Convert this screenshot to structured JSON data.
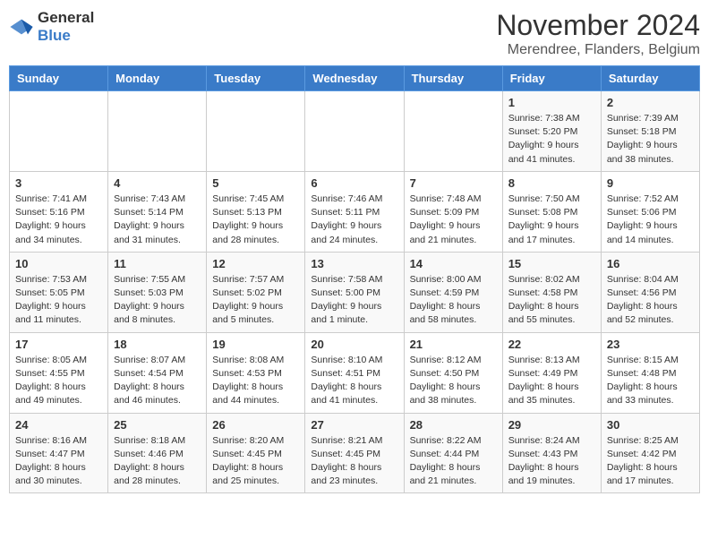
{
  "logo": {
    "text_general": "General",
    "text_blue": "Blue"
  },
  "title": {
    "month": "November 2024",
    "location": "Merendree, Flanders, Belgium"
  },
  "weekdays": [
    "Sunday",
    "Monday",
    "Tuesday",
    "Wednesday",
    "Thursday",
    "Friday",
    "Saturday"
  ],
  "weeks": [
    [
      null,
      null,
      null,
      null,
      null,
      {
        "day": "1",
        "sunrise": "Sunrise: 7:38 AM",
        "sunset": "Sunset: 5:20 PM",
        "daylight": "Daylight: 9 hours and 41 minutes."
      },
      {
        "day": "2",
        "sunrise": "Sunrise: 7:39 AM",
        "sunset": "Sunset: 5:18 PM",
        "daylight": "Daylight: 9 hours and 38 minutes."
      }
    ],
    [
      {
        "day": "3",
        "sunrise": "Sunrise: 7:41 AM",
        "sunset": "Sunset: 5:16 PM",
        "daylight": "Daylight: 9 hours and 34 minutes."
      },
      {
        "day": "4",
        "sunrise": "Sunrise: 7:43 AM",
        "sunset": "Sunset: 5:14 PM",
        "daylight": "Daylight: 9 hours and 31 minutes."
      },
      {
        "day": "5",
        "sunrise": "Sunrise: 7:45 AM",
        "sunset": "Sunset: 5:13 PM",
        "daylight": "Daylight: 9 hours and 28 minutes."
      },
      {
        "day": "6",
        "sunrise": "Sunrise: 7:46 AM",
        "sunset": "Sunset: 5:11 PM",
        "daylight": "Daylight: 9 hours and 24 minutes."
      },
      {
        "day": "7",
        "sunrise": "Sunrise: 7:48 AM",
        "sunset": "Sunset: 5:09 PM",
        "daylight": "Daylight: 9 hours and 21 minutes."
      },
      {
        "day": "8",
        "sunrise": "Sunrise: 7:50 AM",
        "sunset": "Sunset: 5:08 PM",
        "daylight": "Daylight: 9 hours and 17 minutes."
      },
      {
        "day": "9",
        "sunrise": "Sunrise: 7:52 AM",
        "sunset": "Sunset: 5:06 PM",
        "daylight": "Daylight: 9 hours and 14 minutes."
      }
    ],
    [
      {
        "day": "10",
        "sunrise": "Sunrise: 7:53 AM",
        "sunset": "Sunset: 5:05 PM",
        "daylight": "Daylight: 9 hours and 11 minutes."
      },
      {
        "day": "11",
        "sunrise": "Sunrise: 7:55 AM",
        "sunset": "Sunset: 5:03 PM",
        "daylight": "Daylight: 9 hours and 8 minutes."
      },
      {
        "day": "12",
        "sunrise": "Sunrise: 7:57 AM",
        "sunset": "Sunset: 5:02 PM",
        "daylight": "Daylight: 9 hours and 5 minutes."
      },
      {
        "day": "13",
        "sunrise": "Sunrise: 7:58 AM",
        "sunset": "Sunset: 5:00 PM",
        "daylight": "Daylight: 9 hours and 1 minute."
      },
      {
        "day": "14",
        "sunrise": "Sunrise: 8:00 AM",
        "sunset": "Sunset: 4:59 PM",
        "daylight": "Daylight: 8 hours and 58 minutes."
      },
      {
        "day": "15",
        "sunrise": "Sunrise: 8:02 AM",
        "sunset": "Sunset: 4:58 PM",
        "daylight": "Daylight: 8 hours and 55 minutes."
      },
      {
        "day": "16",
        "sunrise": "Sunrise: 8:04 AM",
        "sunset": "Sunset: 4:56 PM",
        "daylight": "Daylight: 8 hours and 52 minutes."
      }
    ],
    [
      {
        "day": "17",
        "sunrise": "Sunrise: 8:05 AM",
        "sunset": "Sunset: 4:55 PM",
        "daylight": "Daylight: 8 hours and 49 minutes."
      },
      {
        "day": "18",
        "sunrise": "Sunrise: 8:07 AM",
        "sunset": "Sunset: 4:54 PM",
        "daylight": "Daylight: 8 hours and 46 minutes."
      },
      {
        "day": "19",
        "sunrise": "Sunrise: 8:08 AM",
        "sunset": "Sunset: 4:53 PM",
        "daylight": "Daylight: 8 hours and 44 minutes."
      },
      {
        "day": "20",
        "sunrise": "Sunrise: 8:10 AM",
        "sunset": "Sunset: 4:51 PM",
        "daylight": "Daylight: 8 hours and 41 minutes."
      },
      {
        "day": "21",
        "sunrise": "Sunrise: 8:12 AM",
        "sunset": "Sunset: 4:50 PM",
        "daylight": "Daylight: 8 hours and 38 minutes."
      },
      {
        "day": "22",
        "sunrise": "Sunrise: 8:13 AM",
        "sunset": "Sunset: 4:49 PM",
        "daylight": "Daylight: 8 hours and 35 minutes."
      },
      {
        "day": "23",
        "sunrise": "Sunrise: 8:15 AM",
        "sunset": "Sunset: 4:48 PM",
        "daylight": "Daylight: 8 hours and 33 minutes."
      }
    ],
    [
      {
        "day": "24",
        "sunrise": "Sunrise: 8:16 AM",
        "sunset": "Sunset: 4:47 PM",
        "daylight": "Daylight: 8 hours and 30 minutes."
      },
      {
        "day": "25",
        "sunrise": "Sunrise: 8:18 AM",
        "sunset": "Sunset: 4:46 PM",
        "daylight": "Daylight: 8 hours and 28 minutes."
      },
      {
        "day": "26",
        "sunrise": "Sunrise: 8:20 AM",
        "sunset": "Sunset: 4:45 PM",
        "daylight": "Daylight: 8 hours and 25 minutes."
      },
      {
        "day": "27",
        "sunrise": "Sunrise: 8:21 AM",
        "sunset": "Sunset: 4:45 PM",
        "daylight": "Daylight: 8 hours and 23 minutes."
      },
      {
        "day": "28",
        "sunrise": "Sunrise: 8:22 AM",
        "sunset": "Sunset: 4:44 PM",
        "daylight": "Daylight: 8 hours and 21 minutes."
      },
      {
        "day": "29",
        "sunrise": "Sunrise: 8:24 AM",
        "sunset": "Sunset: 4:43 PM",
        "daylight": "Daylight: 8 hours and 19 minutes."
      },
      {
        "day": "30",
        "sunrise": "Sunrise: 8:25 AM",
        "sunset": "Sunset: 4:42 PM",
        "daylight": "Daylight: 8 hours and 17 minutes."
      }
    ]
  ]
}
